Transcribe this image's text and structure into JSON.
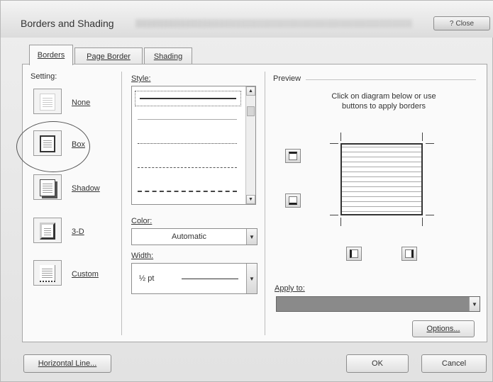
{
  "window": {
    "title": "Borders and Shading",
    "close_label": "Close"
  },
  "tabs": [
    {
      "label": "Borders",
      "active": true
    },
    {
      "label": "Page Border",
      "active": false
    },
    {
      "label": "Shading",
      "active": false
    }
  ],
  "setting": {
    "label": "Setting:",
    "options": [
      {
        "label": "None",
        "icon": "setting-none-icon",
        "selected": false
      },
      {
        "label": "Box",
        "icon": "setting-box-icon",
        "selected": true
      },
      {
        "label": "Shadow",
        "icon": "setting-shadow-icon",
        "selected": false
      },
      {
        "label": "3-D",
        "icon": "setting-3d-icon",
        "selected": false
      },
      {
        "label": "Custom",
        "icon": "setting-custom-icon",
        "selected": false
      }
    ]
  },
  "style": {
    "label": "Style:",
    "items": [
      {
        "kind": "solid",
        "selected": true
      },
      {
        "kind": "thin",
        "selected": false
      },
      {
        "kind": "dotted",
        "selected": false
      },
      {
        "kind": "dashed",
        "selected": false
      },
      {
        "kind": "dash-dot",
        "selected": false
      }
    ]
  },
  "color": {
    "label": "Color:",
    "value": "Automatic"
  },
  "width": {
    "label": "Width:",
    "value": "½ pt"
  },
  "preview": {
    "label": "Preview",
    "instructions_line1": "Click on diagram below or use",
    "instructions_line2": "buttons to apply borders"
  },
  "apply_to": {
    "label": "Apply to:",
    "value": ""
  },
  "buttons": {
    "options": "Options...",
    "horizontal_line": "Horizontal Line...",
    "ok": "OK",
    "cancel": "Cancel"
  },
  "colors": {
    "selection": "#8a8a8a",
    "border": "#333333"
  }
}
